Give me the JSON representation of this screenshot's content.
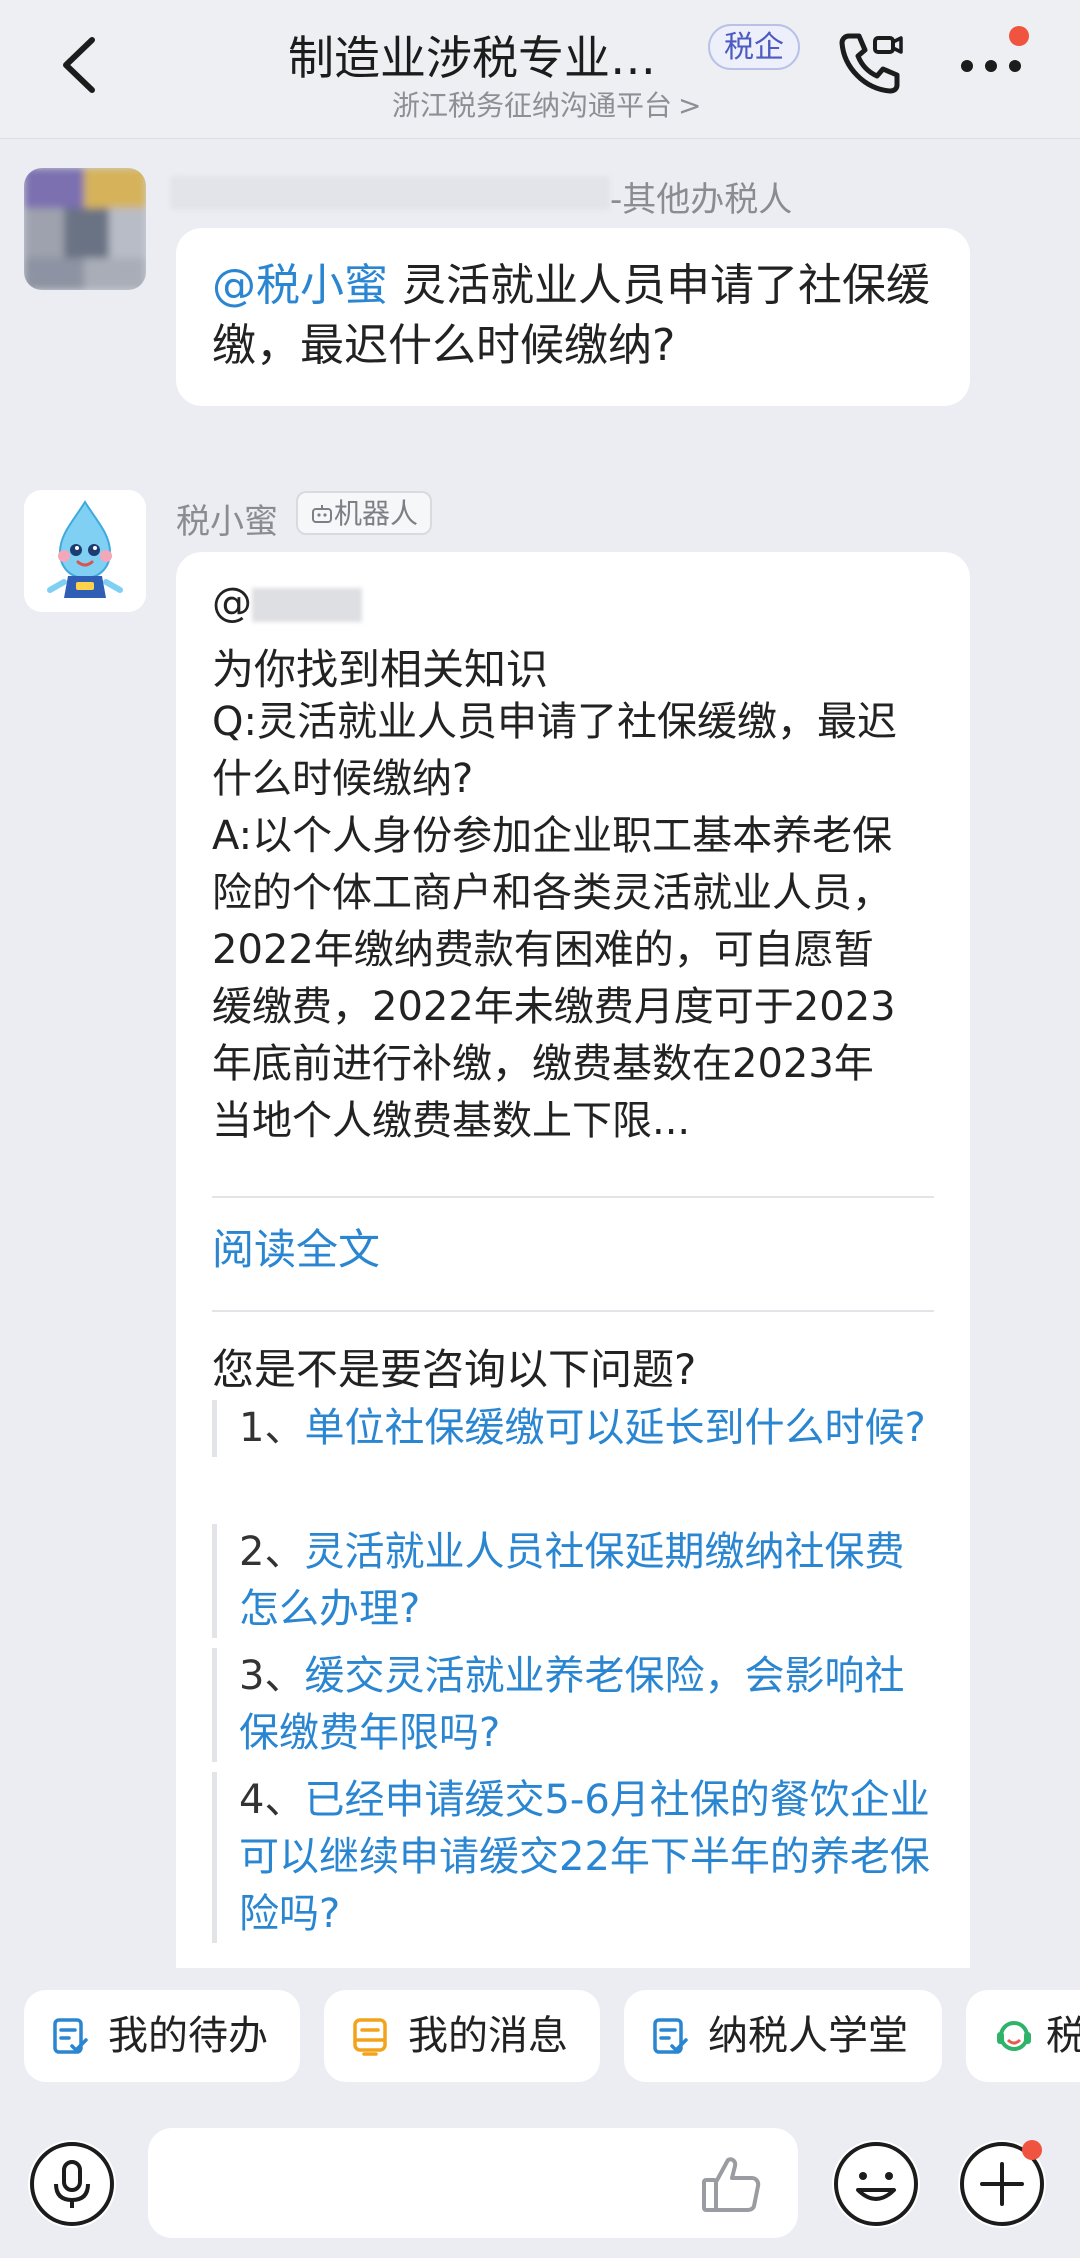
{
  "header": {
    "title": "制造业涉税专业…",
    "badge": "税企",
    "subtitle": "浙江税务征纳沟通平台",
    "subtitle_chevron": ">"
  },
  "messages": [
    {
      "sender_suffix": "-其他办税人",
      "mention": "@税小蜜",
      "text": " 灵活就业人员申请了社保缓缴，最迟什么时候缴纳?"
    },
    {
      "sender": "税小蜜",
      "tag": "机器人",
      "at": "@",
      "found": "为你找到相关知识",
      "answer": "Q:灵活就业人员申请了社保缓缴，最迟\n什么时候缴纳?\nA:以个人身份参加企业职工基本养老保\n险的个体工商户和各类灵活就业人员，\n2022年缴纳费款有困难的，可自愿暂\n缓缴费，2022年未缴费月度可于2023\n年底前进行补缴，缴费基数在2023年\n当地个人缴费基数上下限...",
      "read_all": "阅读全文",
      "suggest_title": "您是不是要咨询以下问题?",
      "questions": [
        {
          "num": "1、",
          "text": "单位社保缓缴可以延长到什么时候?"
        },
        {
          "num": "2、",
          "text": "灵活就业人员社保延期缴纳社保费怎么办理?"
        },
        {
          "num": "3、",
          "text": "缓交灵活就业养老保险，会影响社保缴费年限吗?"
        },
        {
          "num": "4、",
          "text": "已经申请缓交5-6月社保的餐饮企业可以继续申请缓交22年下半年的养老保险吗?"
        }
      ]
    }
  ],
  "quick_actions": [
    {
      "label": "我的待办",
      "icon": "todo-icon"
    },
    {
      "label": "我的消息",
      "icon": "message-icon"
    },
    {
      "label": "纳税人学堂",
      "icon": "classroom-icon"
    },
    {
      "label": "税",
      "icon": "service-icon"
    }
  ],
  "input": {
    "placeholder": ""
  },
  "colors": {
    "accent": "#2a86d1",
    "badge_text": "#4b5bbf",
    "notification": "#f0533f",
    "message_icon": "#f2a31b"
  }
}
